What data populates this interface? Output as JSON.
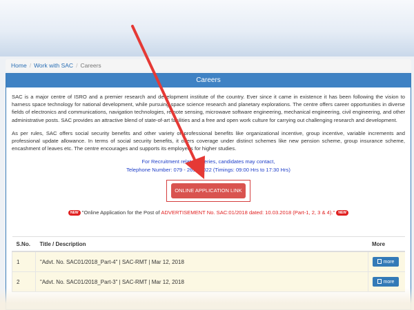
{
  "breadcrumb": {
    "home": "Home",
    "work": "Work with SAC",
    "current": "Careers",
    "separator": "/"
  },
  "panel": {
    "title": "Careers",
    "para1": "SAC is a major centre of ISRO and a premier research and development institute of the country. Ever since it came in existence it has been following the vision to harness space technology for national development, while pursuing space science research and planetary explorations. The centre offers career opportunities in diverse fields of electronics and communications, navigation technologies, remote sensing, microwave software engineering, mechanical engineering, civil engineering, and other administrative posts. SAC provides an attractive blend of state-of-art facilities and a free and open work culture for carrying out challenging research and development.",
    "para2": "As per rules, SAC offers social security benefits and other variety of professional benefits like organizational incentive, group incentive, variable increments and professional update allowance. In terms of social security benefits, it offers coverage under distinct schemes like new pension scheme, group insurance scheme, encashment of leaves etc. The centre encourages and supports its employees for higher studies.",
    "contact_line1": "For Recruitment related queries, candidates may contact,",
    "contact_line2": "Telephone Number: 079 - 2691 3022 (Timings: 09:00 Hrs to 17:30 Hrs)",
    "apply_button": "ONLINE APPLICATION LINK",
    "notice_badge": "NEW",
    "notice_prefix": "\"Online Application for the Post of",
    "notice_highlight": "ADVERTISEMENT No. SAC:01/2018 dated: 10.03.2018 (Part-1, 2, 3 & 4).\""
  },
  "table": {
    "headers": [
      "S.No.",
      "Title / Description",
      "More"
    ],
    "rows": [
      {
        "sno": "1",
        "title": "\"Advt. No. SAC01/2018_Part-4\" | SAC-RMT | Mar 12, 2018",
        "more": "more"
      },
      {
        "sno": "2",
        "title": "\"Advt. No. SAC01/2018_Part-3\" | SAC-RMT | Mar 12, 2018",
        "more": "more"
      }
    ]
  },
  "colors": {
    "panel_header": "#3f82c4",
    "apply_button": "#d9534f",
    "annotation_arrow": "#e53935",
    "row_highlight": "#fcf8e3"
  }
}
